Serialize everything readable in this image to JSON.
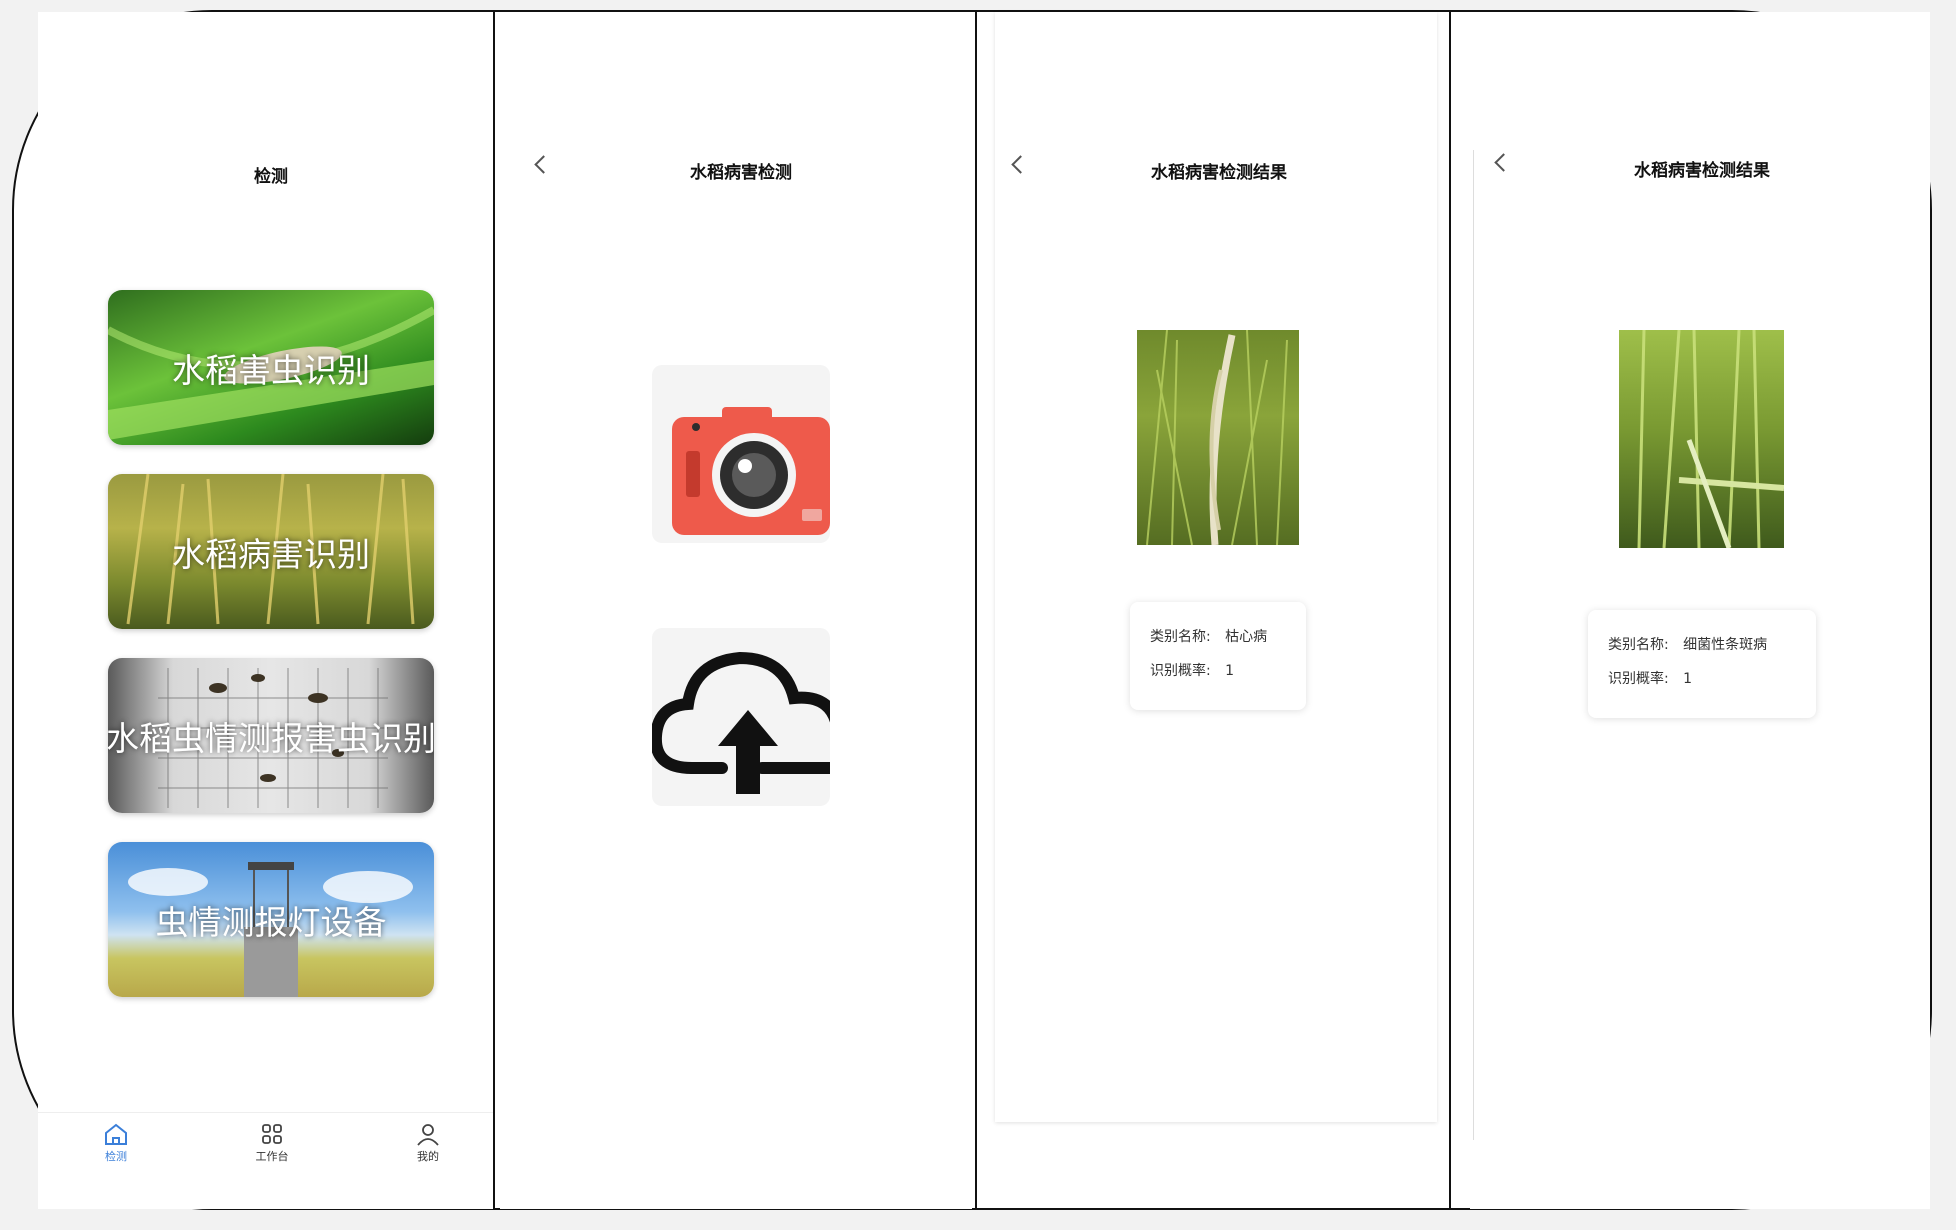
{
  "screen1": {
    "title": "检测",
    "cards": [
      {
        "label": "水稻害虫识别"
      },
      {
        "label": "水稻病害识别"
      },
      {
        "label": "水稻虫情测报害虫识别"
      },
      {
        "label": "虫情测报灯设备"
      }
    ],
    "tabbar": [
      {
        "label": "检测",
        "icon": "home-icon",
        "active": true
      },
      {
        "label": "工作台",
        "icon": "grid-icon",
        "active": false
      },
      {
        "label": "我的",
        "icon": "user-icon",
        "active": false
      }
    ]
  },
  "screen2": {
    "title": "水稻病害检测",
    "buttons": [
      {
        "icon": "camera-icon"
      },
      {
        "icon": "cloud-upload-icon"
      }
    ]
  },
  "screen3": {
    "title": "水稻病害检测结果",
    "category_label": "类别名称:",
    "category_value": "枯心病",
    "prob_label": "识别概率:",
    "prob_value": "1"
  },
  "screen4": {
    "title": "水稻病害检测结果",
    "category_label": "类别名称:",
    "category_value": "细菌性条斑病",
    "prob_label": "识别概率:",
    "prob_value": "1"
  },
  "colors": {
    "accent": "#3b7fd9",
    "camera_body": "#ee5a4b"
  }
}
